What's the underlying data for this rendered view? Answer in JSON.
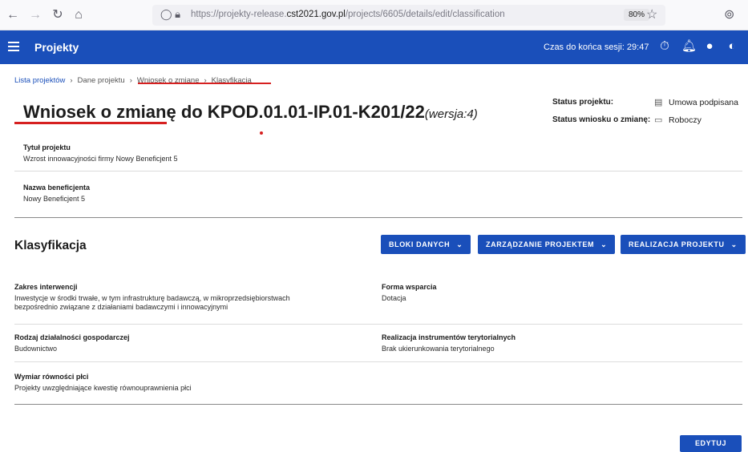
{
  "browser": {
    "url_prefix": "https://projekty-release.",
    "url_domain": "cst2021.gov.pl",
    "url_path": "/projects/6605/details/edit/classification",
    "zoom": "80%"
  },
  "header": {
    "app_title": "Projekty",
    "session_label": "Czas do końca sesji: 29:47"
  },
  "breadcrumb": {
    "items": [
      "Lista projektów",
      "Dane projektu",
      "Wniosek o zmianę",
      "Klasyfikacja"
    ]
  },
  "title": {
    "main": "Wniosek o zmianę do KPOD.01.01-IP.01-K201/22",
    "version": "(wersja:4)"
  },
  "status": {
    "project_label": "Status projektu:",
    "project_value": "Umowa podpisana",
    "request_label": "Status wniosku o zmianę:",
    "request_value": "Roboczy"
  },
  "project_info": {
    "title_label": "Tytuł projektu",
    "title_value": "Wzrost innowacyjności firmy Nowy Beneficjent 5",
    "beneficiary_label": "Nazwa beneficjenta",
    "beneficiary_value": "Nowy Beneficjent 5"
  },
  "section": {
    "title": "Klasyfikacja",
    "buttons": [
      "BLOKI DANYCH",
      "ZARZĄDZANIE PROJEKTEM",
      "REALIZACJA PROJEKTU"
    ]
  },
  "classification": {
    "intervention_label": "Zakres interwencji",
    "intervention_value_1": "Inwestycje w środki trwałe, w tym infrastrukturę badawczą, w mikroprzedsiębiorstwach",
    "intervention_value_2": "bezpośrednio związane z działaniami badawczymi i innowacyjnymi",
    "support_label": "Forma wsparcia",
    "support_value": "Dotacja",
    "activity_label": "Rodzaj działalności gospodarczej",
    "activity_value": "Budownictwo",
    "territorial_label": "Realizacja instrumentów terytorialnych",
    "territorial_value": "Brak ukierunkowania terytorialnego",
    "gender_label": "Wymiar równości płci",
    "gender_value": "Projekty uwzględniające kwestię równouprawnienia płci"
  },
  "actions": {
    "edit": "EDYTUJ"
  },
  "colors": {
    "primary": "#1a4fba",
    "annotation": "#d62020"
  }
}
